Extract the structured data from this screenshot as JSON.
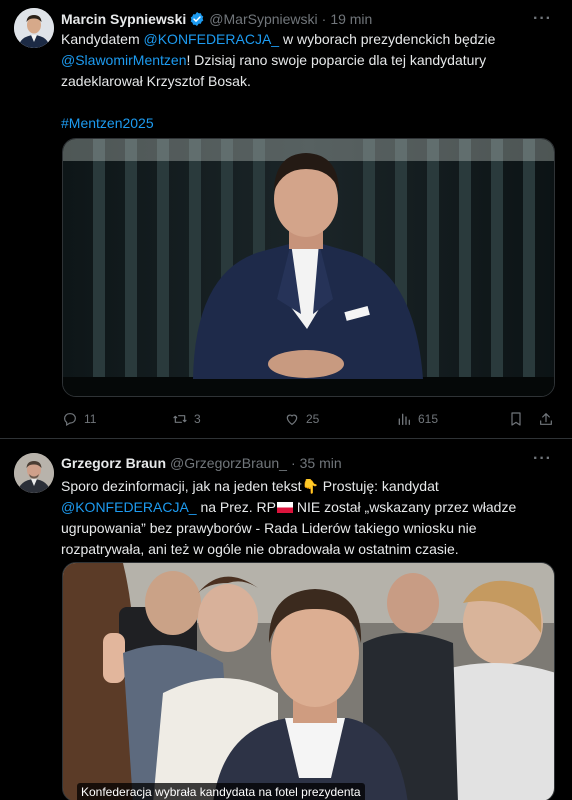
{
  "tweets": [
    {
      "author": "Marcin Sypniewski",
      "handle": "@MarSypniewski",
      "separator": "·",
      "time": "19 min",
      "verified": true,
      "text": {
        "w1": "Kandydatem ",
        "mention1": "@KONFEDERACJA_",
        "w2": " w wyborach prezydenckich będzie ",
        "mention2": "@SlawomirMentzen",
        "w3": "! Dzisiaj rano swoje poparcie dla tej kandydatury zadeklarował Krzysztof Bosak.",
        "hashtag": "#Mentzen2025"
      },
      "metrics": {
        "replies": "11",
        "reposts": "3",
        "likes": "25",
        "views": "615"
      }
    },
    {
      "author": "Grzegorz Braun",
      "handle": "@GrzegorzBraun_",
      "separator": "·",
      "time": "35 min",
      "text": {
        "w1": "Sporo dezinformacji, jak na jeden tekst",
        "emoji1": "👇",
        "w2": " Prostuję: kandydat ",
        "mention1": "@KONFEDERACJA_",
        "w3": " na Prez. RP",
        "w4": " NIE został „wskazany przez władze ugrupowania” bez prawyborów - Rada Liderów takiego wniosku nie rozpatrywała, ani też w ogóle nie obradowała w ostatnim czasie."
      },
      "media_caption": "Konfederacja wybrała kandydata na fotel prezydenta"
    }
  ],
  "icons": {
    "more": "more-icon",
    "reply": "reply-icon",
    "repost": "repost-icon",
    "like": "like-icon",
    "views": "views-icon",
    "bookmark": "bookmark-icon",
    "share": "share-icon"
  },
  "colors": {
    "background": "#000000",
    "link": "#1d9bf0",
    "muted": "#71767b",
    "verified": "#1d9bf0"
  }
}
